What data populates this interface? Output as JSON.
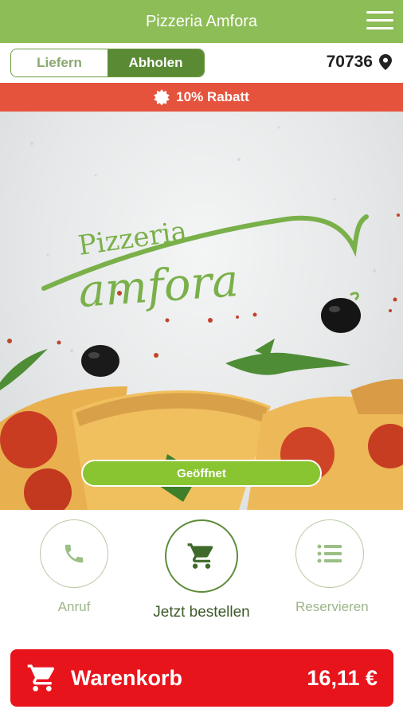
{
  "header": {
    "title": "Pizzeria Amfora",
    "menu_icon": "hamburger-menu-icon"
  },
  "mode": {
    "deliver_label": "Liefern",
    "pickup_label": "Abholen",
    "selected": "Abholen"
  },
  "location": {
    "zip": "70736",
    "icon": "map-pin-icon"
  },
  "promo": {
    "label": "10% Rabatt",
    "icon": "badge-icon"
  },
  "hero": {
    "logo_line1": "Pizzeria",
    "logo_line2": "amfora",
    "status_label": "Geöffnet"
  },
  "actions": [
    {
      "label": "Anruf",
      "icon": "phone-icon"
    },
    {
      "label": "Jetzt bestellen",
      "icon": "cart-icon"
    },
    {
      "label": "Reservieren",
      "icon": "list-icon"
    }
  ],
  "cart": {
    "label": "Warenkorb",
    "total": "16,11 €",
    "icon": "cart-icon"
  },
  "colors": {
    "primary_green": "#8dbd56",
    "dark_green": "#5a8a34",
    "promo_red": "#e5533c",
    "cart_red": "#e8141c"
  }
}
